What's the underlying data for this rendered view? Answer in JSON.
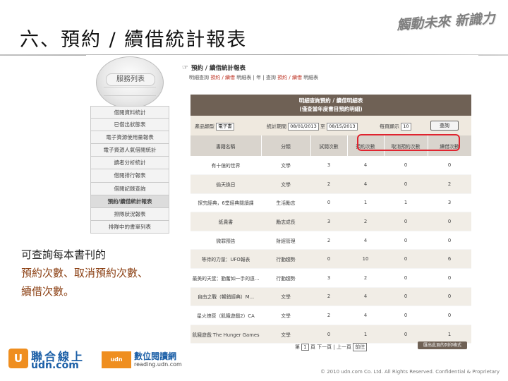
{
  "slide": {
    "title": "六、預約 / 續借統計報表",
    "slogan": "觸動未來 新識力",
    "note_line1": "可查詢每本書刊的",
    "note_line2": "預約次數、取消預約次數、",
    "note_line3": "續借次數。",
    "footer": "© 2010 udn.com Co. Ltd. All Rights Reserved. Confidential & Proprietary"
  },
  "logos": {
    "udn_mark": "U",
    "udn_name": "聯合線上",
    "udn_url": "udn.com",
    "reading_mark": "udn",
    "reading_name": "數位閱讀網",
    "reading_url": "reading.udn.com"
  },
  "menu": {
    "title": "服務列表",
    "items": [
      {
        "label": "借閱資料統計"
      },
      {
        "label": "已借出狀態表"
      },
      {
        "label": "電子資源使用量報表"
      },
      {
        "label": "電子資源人氣借閱統計"
      },
      {
        "label": "讀者分析統計"
      },
      {
        "label": "借閱排行報表"
      },
      {
        "label": "借閱記錄查詢"
      },
      {
        "label": "預約/續借統計報表",
        "active": true
      },
      {
        "label": "排隊狀況報表"
      },
      {
        "label": "排隊中的書單列表"
      }
    ]
  },
  "page": {
    "hand": "☞",
    "heading": "預約 / 續借統計報表",
    "breadcrumb_prefix": "明細查詢",
    "breadcrumb_link1": "預約 / 續借",
    "breadcrumb_mid": "明細表 | 年 | 查詢",
    "breadcrumb_link2": "預約 / 續借",
    "breadcrumb_suffix": "明細表",
    "report_title": "明細查詢預約 / 續借明細表",
    "report_subtitle": "(僅查當年度書目預約明細)",
    "filters": {
      "product_label": "產品類型",
      "product_value": "電子書",
      "date_label": "統計期間",
      "date_from": "08/01/2013",
      "date_sep": "至",
      "date_to": "08/15/2013",
      "page_size_label": "每頁顯示",
      "page_size_value": "10",
      "query_button": "查詢"
    },
    "columns": [
      "書籍名稱",
      "分類",
      "試閱次數",
      "預約次數",
      "取消預約次數",
      "續借次數"
    ],
    "rows": [
      [
        "有十億的世界",
        "文學",
        "3",
        "4",
        "0",
        "0"
      ],
      [
        "偷天換日",
        "文學",
        "2",
        "4",
        "0",
        "2"
      ],
      [
        "探究經典，6堂經典閱讀課",
        "生活勵志",
        "0",
        "1",
        "1",
        "3"
      ],
      [
        "紙貴書",
        "勵志成長",
        "3",
        "2",
        "0",
        "0"
      ],
      [
        "微罪預告",
        "財經管理",
        "2",
        "4",
        "0",
        "0"
      ],
      [
        "等待的力量：UFO報表",
        "行動趨勢",
        "0",
        "10",
        "0",
        "6"
      ],
      [
        "最美的天堂：勤奮如一手的遠...",
        "行動趨勢",
        "3",
        "2",
        "0",
        "0"
      ],
      [
        "自由之戰（暢銷經典）M...",
        "文學",
        "2",
        "4",
        "0",
        "0"
      ],
      [
        "星火燎原（飢餓遊戲2）CA",
        "文學",
        "2",
        "4",
        "0",
        "0"
      ],
      [
        "飢餓遊戲 The Hunger Games",
        "文學",
        "0",
        "1",
        "0",
        "1"
      ]
    ],
    "pager_prefix": "第",
    "pager_page": "1",
    "pager_suffix": "頁 下一頁 | 上一頁",
    "pager_goto": "前往",
    "print_button": "匯出此頁的列印格式"
  }
}
